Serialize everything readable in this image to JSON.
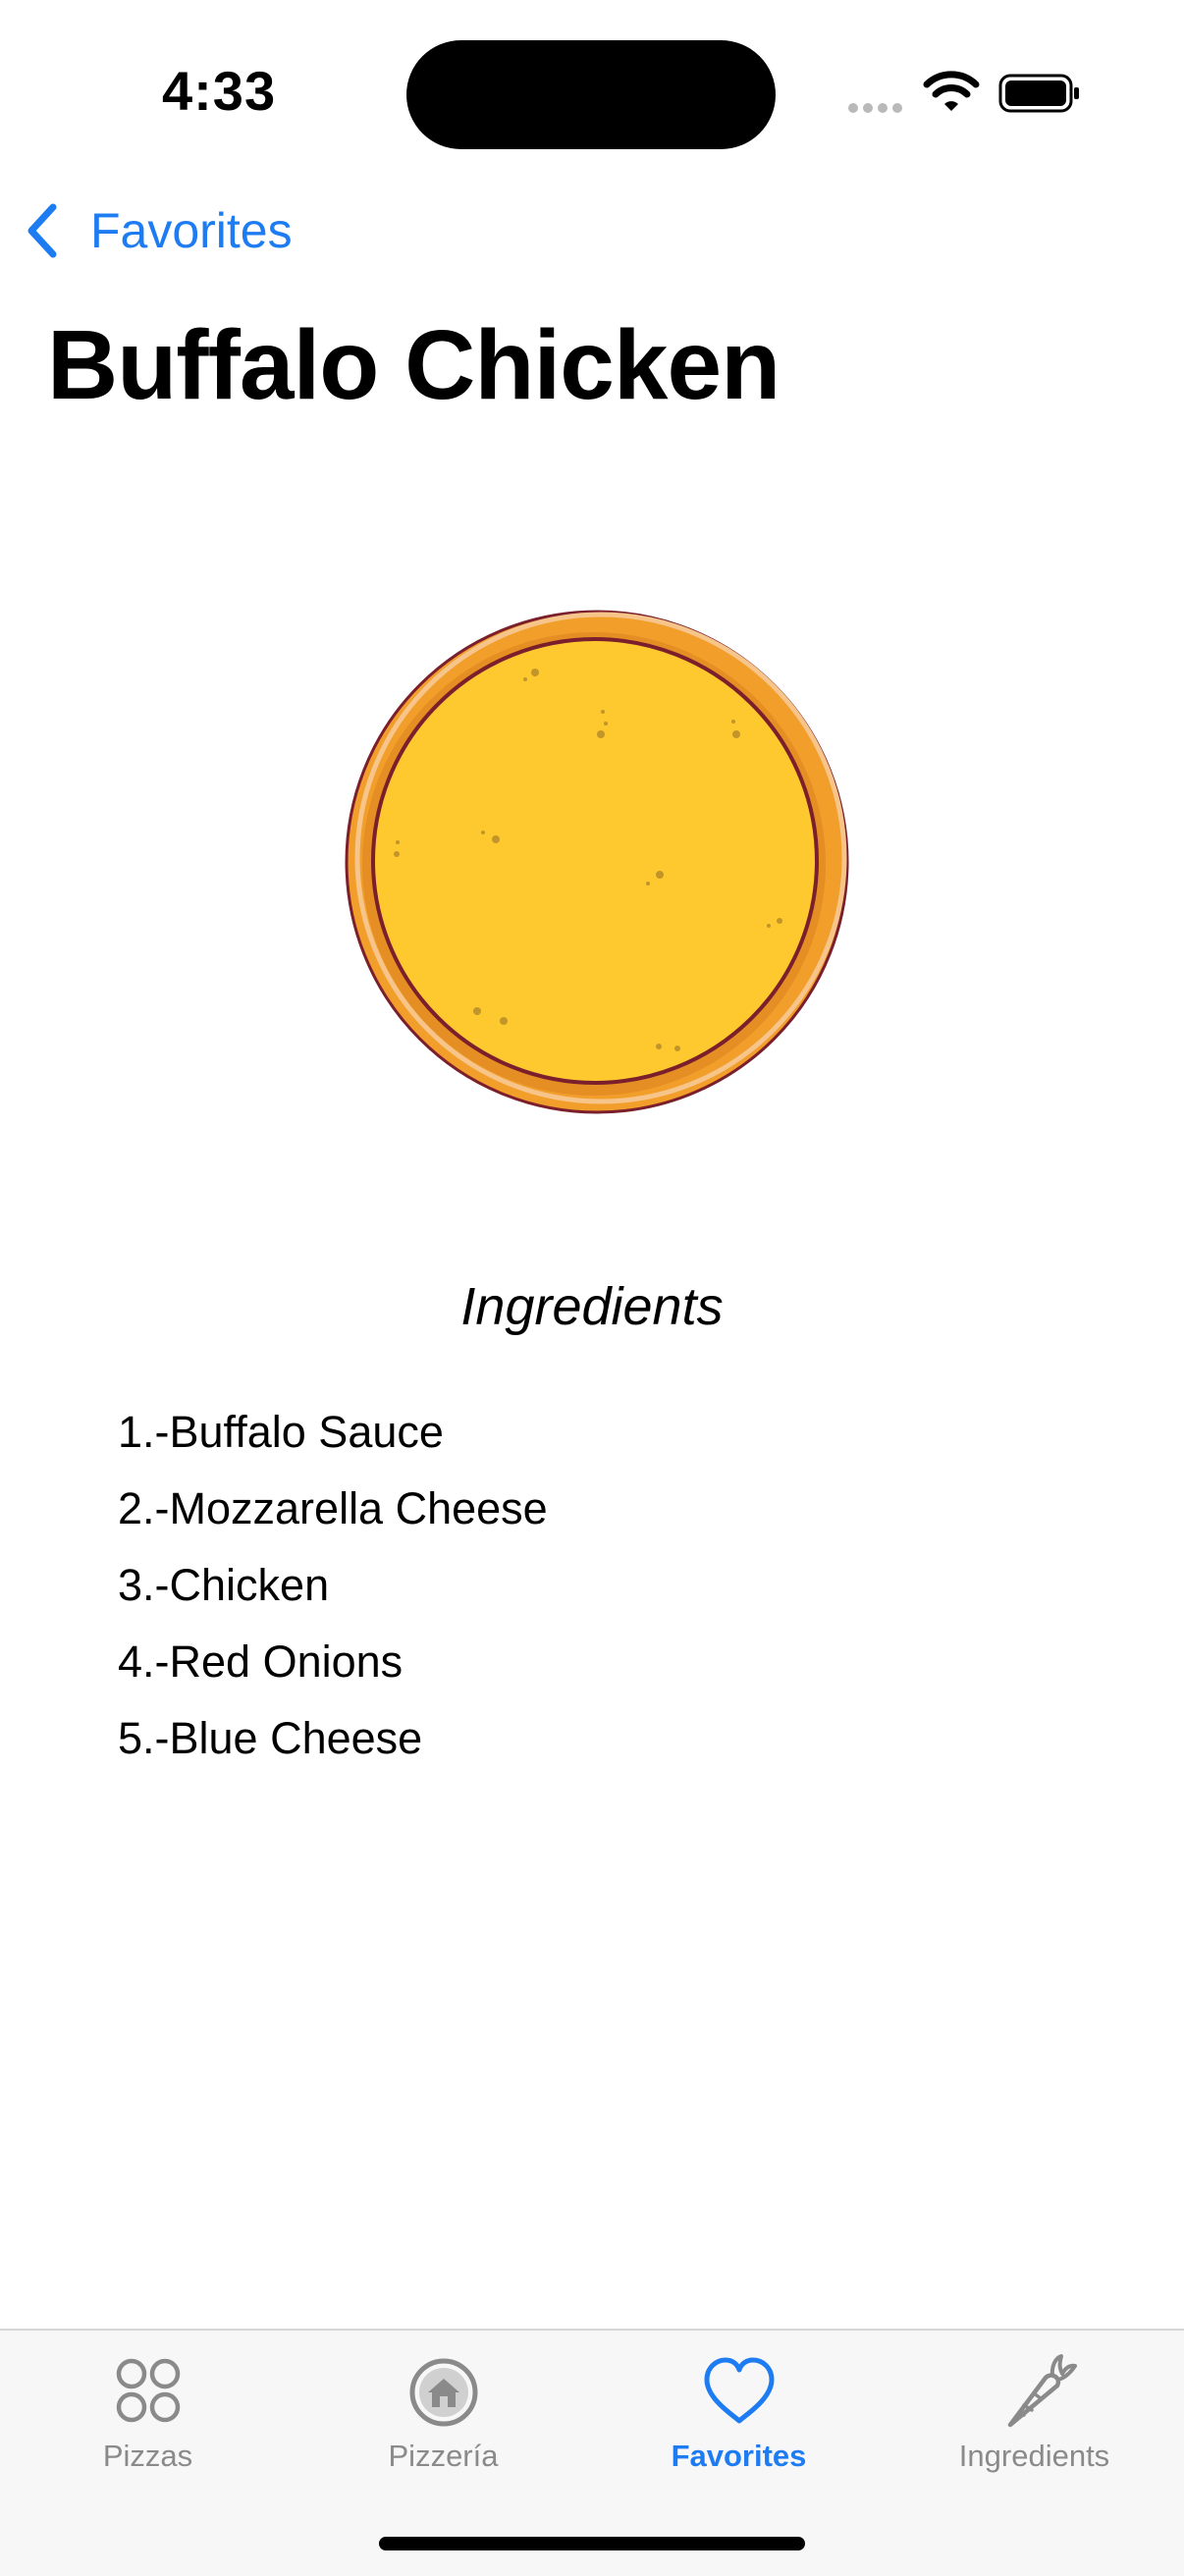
{
  "status_bar": {
    "time": "4:33"
  },
  "nav": {
    "back_label": "Favorites"
  },
  "page": {
    "title": "Buffalo Chicken"
  },
  "ingredients": {
    "title": "Ingredients",
    "items": [
      "1.-Buffalo Sauce",
      "2.-Mozzarella Cheese",
      "3.-Chicken",
      "4.-Red Onions",
      "5.-Blue Cheese"
    ]
  },
  "tab_bar": {
    "tabs": [
      {
        "label": "Pizzas",
        "icon": "grid-circles-icon",
        "active": false
      },
      {
        "label": "Pizzería",
        "icon": "home-circle-icon",
        "active": false
      },
      {
        "label": "Favorites",
        "icon": "heart-icon",
        "active": true
      },
      {
        "label": "Ingredients",
        "icon": "carrot-icon",
        "active": false
      }
    ]
  },
  "colors": {
    "accent": "#1e7cf2",
    "inactive": "#8a8a8a",
    "cheese": "#fdc92f",
    "crust": "#f19e2a"
  }
}
